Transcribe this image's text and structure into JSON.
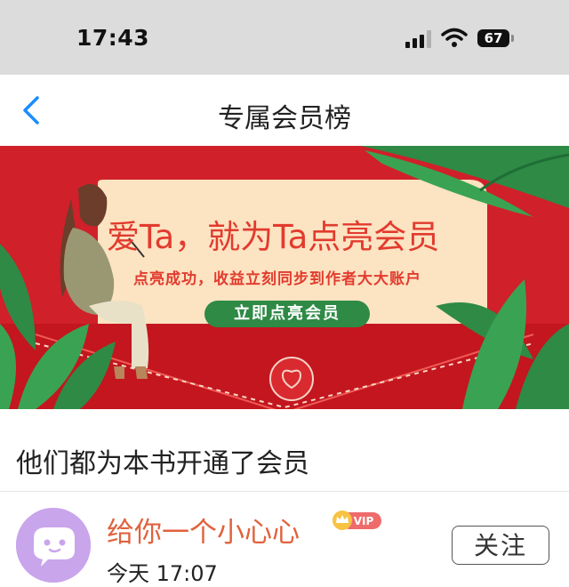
{
  "status_bar": {
    "time": "17:43",
    "battery": "67"
  },
  "nav": {
    "title": "专属会员榜"
  },
  "banner": {
    "headline": "爱Ta，就为Ta点亮会员",
    "subtext": "点亮成功，收益立刻同步到作者大大账户",
    "cta_label": "立即点亮会员"
  },
  "section": {
    "title": "他们都为本书开通了会员"
  },
  "members": [
    {
      "name": "给你一个小心心",
      "badge": "VIP",
      "time": "今天 17:07",
      "follow_label": "关注"
    }
  ],
  "colors": {
    "status_bar_bg": "#dcdcdc",
    "banner_red": "#d0202a",
    "accent_orange": "#e0623d",
    "cta_green": "#2e8a45",
    "back_blue": "#1a8cff",
    "avatar_purple": "#c9a5ec"
  },
  "icons": {
    "back": "chevron-left-icon",
    "signal": "signal-icon",
    "wifi": "wifi-icon",
    "battery": "battery-icon",
    "vip": "vip-crown-icon",
    "avatar": "chat-bubble-face-icon"
  }
}
